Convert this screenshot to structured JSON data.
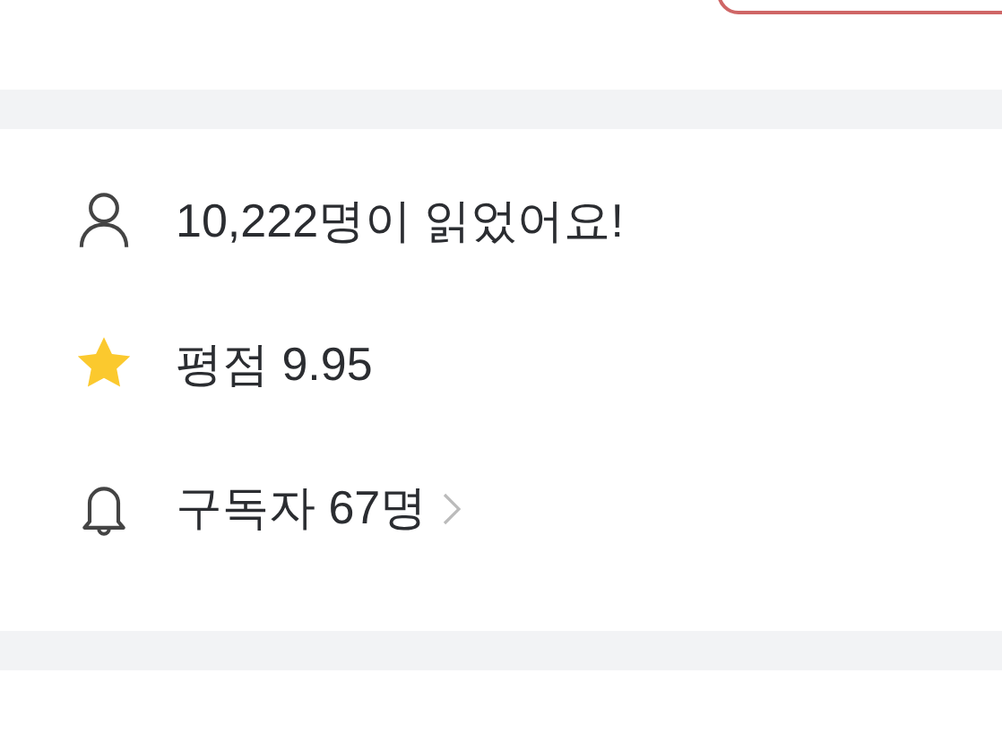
{
  "stats": [
    {
      "kind": "readers",
      "text": "10,222명이 읽었어요!",
      "link": false
    },
    {
      "kind": "rating",
      "text": "평점 9.95",
      "link": false
    },
    {
      "kind": "subscribers",
      "text": "구독자 67명",
      "link": true
    }
  ]
}
